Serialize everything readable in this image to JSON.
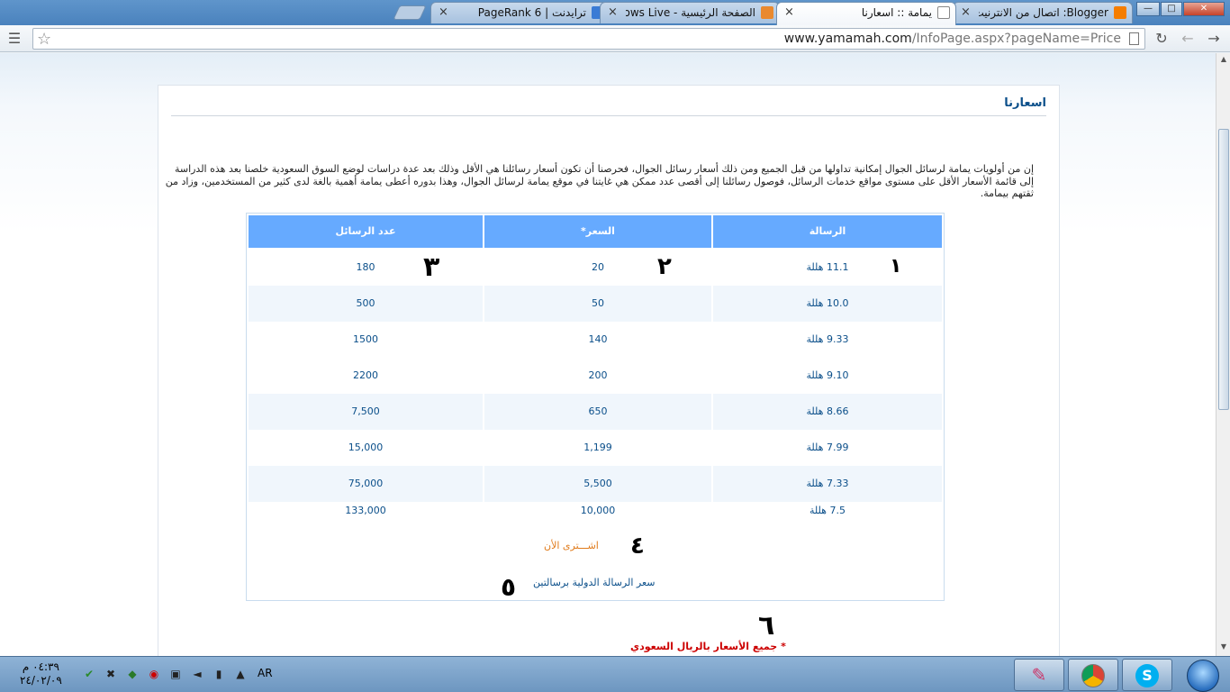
{
  "browser": {
    "tabs": [
      {
        "title": "Blogger: اتصال من الانترنيت",
        "active": false
      },
      {
        "title": "يمامة :: اسعارنا",
        "active": true
      },
      {
        "title": "الصفحة الرئيسية - Windows Live",
        "active": false
      },
      {
        "title": "ترايدنت | PageRank 6",
        "active": false
      }
    ],
    "tab_close_glyph": "×",
    "url": {
      "domain": "www.yamamah.com",
      "path": "/InfoPage.aspx?pageName=Price"
    }
  },
  "page": {
    "heading": "اسعارنا",
    "intro": "إن من أولويات يمامة لرسائل الجوال إمكانية تداولها من قبل الجميع ومن ذلك أسعار رسائل الجوال، فحرصنا أن تكون أسعار رسائلنا هي الأقل وذلك بعد عدة دراسات لوضع السوق السعودية خلصنا بعد هذه الدراسة إلى قائمة الأسعار الأقل على مستوى مواقع خدمات الرسائل، فوصول رسائلنا إلى أقصى عدد ممكن هي غايتنا في موقع يمامة لرسائل الجوال، وهذا بدوره أعطى يمامة أهمية بالغة لدى كثير من المستخدمين، وزاد من ثقتهم بيمامة.",
    "table": {
      "headers": {
        "message": "الرسالة",
        "price": "السعر*",
        "count": "عدد الرسائل"
      },
      "rows": [
        {
          "message": "11.1 هللة",
          "price": "20",
          "count": "180"
        },
        {
          "message": "10.0 هللة",
          "price": "50",
          "count": "500"
        },
        {
          "message": "9.33 هللة",
          "price": "140",
          "count": "1500"
        },
        {
          "message": "9.10 هللة",
          "price": "200",
          "count": "2200"
        },
        {
          "message": "8.66 هللة",
          "price": "650",
          "count": "7,500"
        },
        {
          "message": "7.99 هللة",
          "price": "1,199",
          "count": "15,000"
        },
        {
          "message": "7.33 هللة",
          "price": "5,500",
          "count": "75,000"
        },
        {
          "message": "7.5 هللة",
          "price": "10,000",
          "count": "133,000"
        }
      ]
    },
    "buy_link": "اشـــترى الأن",
    "intl_link": "سعر الرسالة الدولية برسالتين",
    "note_star": "*",
    "note": "جميع الأسعار بالريال السعودي"
  },
  "annotations": [
    "١",
    "٢",
    "٣",
    "٤",
    "٥",
    "٦"
  ],
  "taskbar": {
    "time": "٠٤:٣٩ م",
    "date": "٢٤/٠٢/٠٩",
    "language": "AR"
  }
}
